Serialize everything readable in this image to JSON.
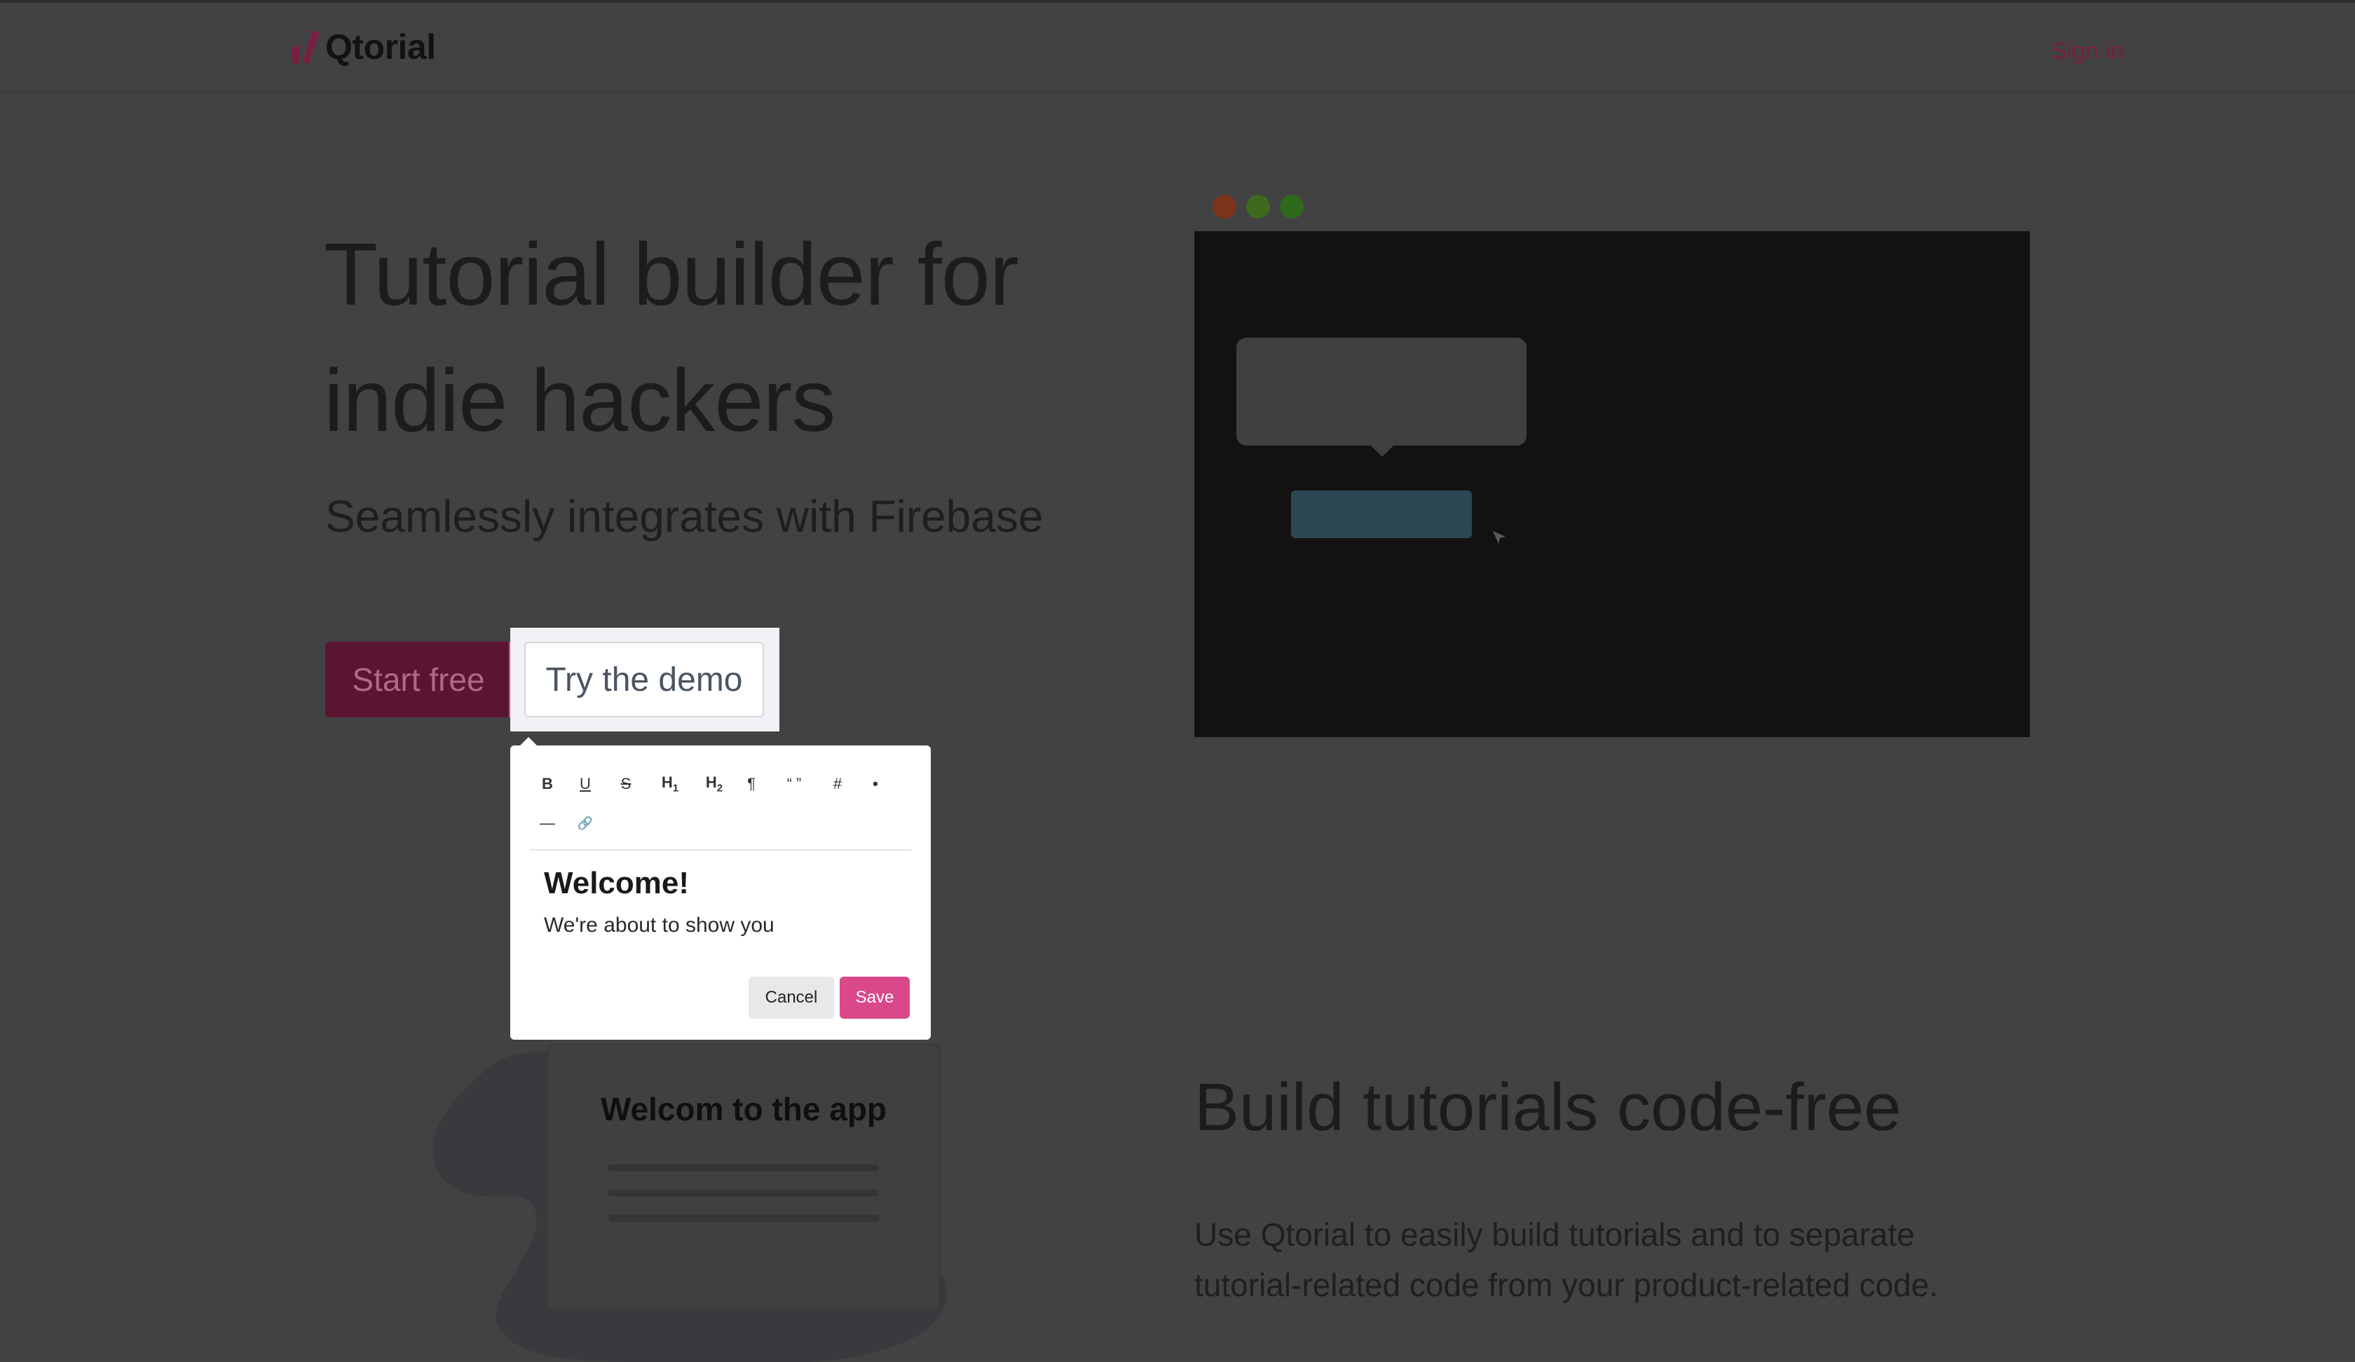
{
  "header": {
    "brand": "Qtorial",
    "signin_label": "Sign in",
    "logo_icon": "qtorial-logo-icon"
  },
  "hero": {
    "title": "Tutorial builder for indie hackers",
    "subtitle": "Seamlessly integrates with Firebase",
    "start_label": "Start free",
    "demo_label": "Try the demo"
  },
  "editor": {
    "toolbar": [
      {
        "name": "bold-icon",
        "glyph": "B"
      },
      {
        "name": "underline-icon",
        "glyph": "U"
      },
      {
        "name": "strikethrough-icon",
        "glyph": "S"
      },
      {
        "name": "heading1-icon",
        "glyph": "H1"
      },
      {
        "name": "heading2-icon",
        "glyph": "H2"
      },
      {
        "name": "paragraph-icon",
        "glyph": "¶"
      },
      {
        "name": "quote-icon",
        "glyph": "“ ”"
      },
      {
        "name": "code-icon",
        "glyph": "#"
      },
      {
        "name": "list-icon",
        "glyph": "•"
      },
      {
        "name": "horizontal-rule-icon",
        "glyph": "—"
      },
      {
        "name": "link-icon",
        "glyph": "🔗"
      }
    ],
    "heading": "Welcome!",
    "body": "We're about to show you",
    "cancel_label": "Cancel",
    "save_label": "Save"
  },
  "mock": {
    "dot_colors": [
      "#7a3418",
      "#3d6a1c",
      "#2f6a1c"
    ]
  },
  "card": {
    "title": "Welcom to the app"
  },
  "feature": {
    "title": "Build tutorials code-free",
    "text": "Use Qtorial to easily build tutorials and to separate tutorial-related code from your product-related code."
  },
  "colors": {
    "brand": "#d9498a",
    "brand_dark": "#5a1532",
    "overlay_bg": "#424242"
  }
}
